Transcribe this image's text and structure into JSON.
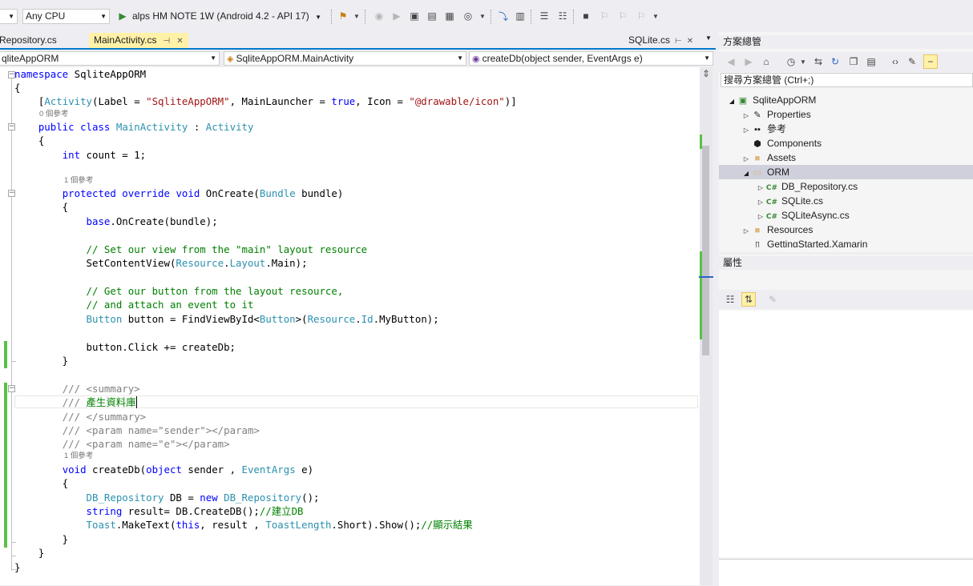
{
  "toolbar": {
    "config_partial": "",
    "platform": "Any CPU",
    "run_target": "alps HM NOTE 1W (Android 4.2 - API 17)"
  },
  "tabs": [
    {
      "label": "Repository.cs",
      "active": false
    },
    {
      "label": "MainActivity.cs",
      "active": true
    },
    {
      "label": "SQLite.cs",
      "active": false
    }
  ],
  "navbar": {
    "project": "qliteAppORM",
    "class": "SqliteAppORM.MainActivity",
    "member": "createDb(object sender, EventArgs e)"
  },
  "code_lens": [
    "0 個參考",
    "1 個參考",
    "1 個參考"
  ],
  "code": [
    "namespace SqliteAppORM",
    "{",
    "[Activity(Label = \"SqliteAppORM\", MainLauncher = true, Icon = \"@drawable/icon\")]",
    "public class MainActivity : Activity",
    "{",
    "int count = 1;",
    "protected override void OnCreate(Bundle bundle)",
    "{",
    "base.OnCreate(bundle);",
    "// Set our view from the \"main\" layout resource",
    "SetContentView(Resource.Layout.Main);",
    "// Get our button from the layout resource,",
    "// and attach an event to it",
    "Button button = FindViewById<Button>(Resource.Id.MyButton);",
    "button.Click += createDb;",
    "}",
    "/// <summary>",
    "/// 產生資料庫",
    "/// </summary>",
    "/// <param name=\"sender\"></param>",
    "/// <param name=\"e\"></param>",
    "void createDb(object sender , EventArgs e)",
    "{",
    "DB_Repository DB = new DB_Repository();",
    "string result= DB.CreateDB();//建立DB",
    "Toast.MakeText(this, result , ToastLength.Short).Show();//顯示結果",
    "}",
    "}",
    "}"
  ],
  "solution_explorer": {
    "title": "方案總管",
    "search_placeholder": "搜尋方案總管 (Ctrl+;)",
    "items": [
      {
        "label": "SqliteAppORM",
        "icon": "project-icon"
      },
      {
        "label": "Properties",
        "icon": "wrench-icon"
      },
      {
        "label": "參考",
        "icon": "references-icon"
      },
      {
        "label": "Components",
        "icon": "components-icon"
      },
      {
        "label": "Assets",
        "icon": "folder-icon"
      },
      {
        "label": "ORM",
        "icon": "folder-open-icon"
      },
      {
        "label": "DB_Repository.cs",
        "icon": "csharp-file-icon"
      },
      {
        "label": "SQLite.cs",
        "icon": "csharp-file-icon"
      },
      {
        "label": "SQLiteAsync.cs",
        "icon": "csharp-file-icon"
      },
      {
        "label": "Resources",
        "icon": "folder-icon"
      },
      {
        "label": "GettingStarted.Xamarin",
        "icon": "file-icon"
      }
    ],
    "cs_badge": "C#"
  },
  "properties": {
    "title": "屬性"
  },
  "colors": {
    "accent": "#007acc",
    "active_tab": "#fff1a8",
    "keyword": "#0000ff",
    "type": "#2b91af",
    "string": "#a31515",
    "comment": "#008000"
  }
}
